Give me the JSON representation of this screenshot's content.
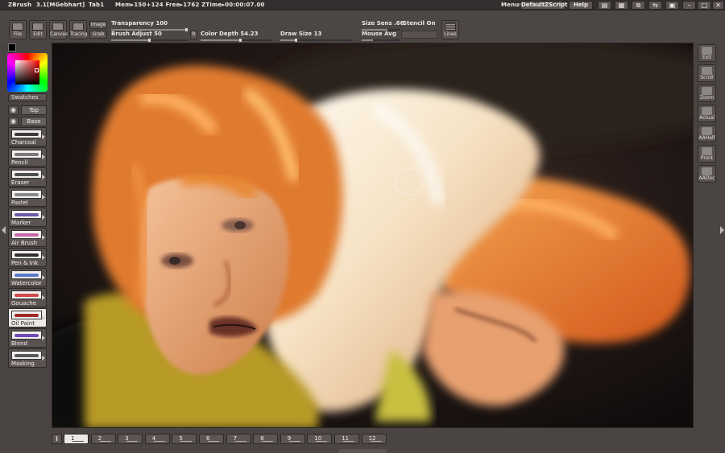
{
  "titlebar": {
    "app": "ZBrush",
    "version": "3.1[MGebhart]",
    "tab": "Tab1",
    "mem": "Mem▸150+124 Free▸1762 ZTime▸00:00:07.00",
    "menus_label": "Menus",
    "script_label": "DefaultZScript",
    "help_label": "Help"
  },
  "toolbar": {
    "tools": [
      {
        "label": "File",
        "icon": "folder-icon"
      },
      {
        "label": "Edit",
        "icon": "edit-icon"
      },
      {
        "label": "Canvas",
        "icon": "canvas-icon"
      },
      {
        "label": "Tracing",
        "icon": "tracing-icon"
      }
    ],
    "image_label": "Image",
    "grab_label": "Grab",
    "transparency_label": "Transparency 100",
    "brush_adjust_label": "Brush Adjust 50",
    "r_label": "R",
    "color_depth_label": "Color Depth 54.23",
    "draw_size_label": "Draw Size 13",
    "size_sens_label": "Size Sens .66",
    "stencil_label": "Stencil On",
    "mouse_avg_label": "Mouse Avg",
    "lines_label": "Lines",
    "transparency_level": 100,
    "brush_adjust_level": 50
  },
  "leftpanel": {
    "swatches_label": "Swatches",
    "top_label": "Top",
    "base_label": "Base",
    "brushes": [
      {
        "name": "Charcoal",
        "color": "#3a3a3a"
      },
      {
        "name": "Pencil",
        "color": "#7a7a7a"
      },
      {
        "name": "Eraser",
        "color": "#505050"
      },
      {
        "name": "Pastel",
        "color": "#8a8a8a"
      },
      {
        "name": "Marker",
        "color": "#6a5aa8"
      },
      {
        "name": "Air Brush",
        "color": "#c46aa8"
      },
      {
        "name": "Pen & Ink",
        "color": "#303030"
      },
      {
        "name": "Watercolor",
        "color": "#5a78c8"
      },
      {
        "name": "Gouache",
        "color": "#d04848"
      },
      {
        "name": "Oil Paint",
        "color": "#a02828"
      },
      {
        "name": "Blend",
        "color": "#7048b8"
      },
      {
        "name": "Masking",
        "color": "#5a5a5a"
      }
    ]
  },
  "rightpanel": {
    "buttons": [
      {
        "label": "Exit",
        "icon": "close-icon"
      },
      {
        "label": "Scroll",
        "icon": "hand-icon"
      },
      {
        "label": "Zoom",
        "icon": "zoom-icon"
      },
      {
        "label": "Actual",
        "icon": "actual-icon"
      },
      {
        "label": "AAHalf",
        "icon": "aahalf-icon"
      },
      {
        "label": "Prsnt",
        "icon": "present-icon"
      },
      {
        "label": "AADoc",
        "icon": "aadoc-icon"
      }
    ]
  },
  "bottombar": {
    "info_label": "i",
    "pages": [
      "1",
      "2",
      "3",
      "4",
      "5",
      "6",
      "7",
      "8",
      "9",
      "10",
      "11",
      "12"
    ],
    "active_page": "1"
  },
  "colors": {
    "background": "#4a4543",
    "canvas_bg": "#141010",
    "primary_color": "#000000",
    "secondary_color": "#ff0000"
  }
}
